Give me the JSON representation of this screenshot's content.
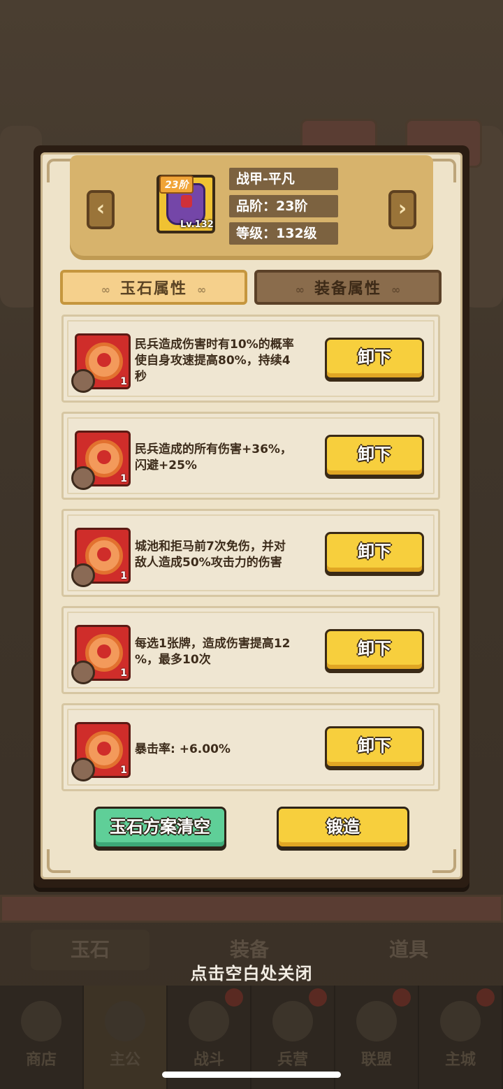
{
  "item": {
    "name": "战甲-平凡",
    "tier_tag": "23阶",
    "level_tag": "Lv.132",
    "quality_text": "品阶：23阶",
    "level_text": "等级：132级",
    "icon": "purple-armor-icon"
  },
  "nav_arrows": {
    "prev": "‹",
    "next": "›"
  },
  "tabs": [
    {
      "label": "玉石属性",
      "active": true
    },
    {
      "label": "装备属性",
      "active": false
    }
  ],
  "gems": [
    {
      "lines": [
        "民兵造成伤害时有10%的概率",
        "使自身攻速提高80%，持续4",
        "秒"
      ],
      "count": "1",
      "button": "卸下"
    },
    {
      "lines": [
        "民兵造成的所有伤害+36%，",
        "闪避+25%"
      ],
      "count": "1",
      "button": "卸下"
    },
    {
      "lines": [
        "城池和拒马前7次免伤，并对",
        "敌人造成50%攻击力的伤害"
      ],
      "count": "1",
      "button": "卸下"
    },
    {
      "lines": [
        "每选1张牌，造成伤害提高12",
        "%，最多10次"
      ],
      "count": "1",
      "button": "卸下"
    },
    {
      "lines": [
        "暴击率: +6.00%"
      ],
      "count": "1",
      "button": "卸下"
    }
  ],
  "actions": {
    "clear_plan": "玉石方案清空",
    "forge": "锻造"
  },
  "close_hint": "点击空白处关闭",
  "background": {
    "category_tabs": [
      "玉石",
      "装备",
      "道具"
    ],
    "nav": [
      "商店",
      "主公",
      "战斗",
      "兵营",
      "联盟",
      "主城"
    ],
    "active_nav": "主公"
  },
  "colors": {
    "panel_bg": "#eee3c9",
    "header_gold": "#d7b36c",
    "button_yellow": "#f7cf3d",
    "button_green": "#5fcf98",
    "gem_red": "#cf2d2a"
  }
}
